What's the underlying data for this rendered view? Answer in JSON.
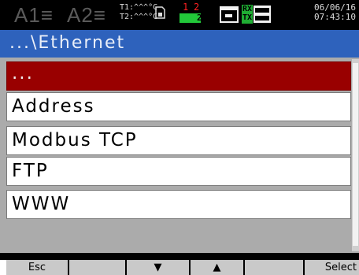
{
  "status_bar": {
    "alarm1": "A1≡",
    "alarm2": "A2≡",
    "t1": "T1:^^^°C",
    "t2": "T2:^^^°C",
    "channel_1": "1",
    "channel_2": "2",
    "channel_percent": "2%",
    "rx": "RX",
    "tx": "TX",
    "date": "06/06/16",
    "time": "07:43:10",
    "colors": {
      "alarm_inactive": "#5a5a5a",
      "channel_1": "#ff2020",
      "channel_2": "#ff2020",
      "bar_green": "#22c83a",
      "rx_bg": "#1fae33"
    }
  },
  "title_bar": {
    "path": "...\\Ethernet"
  },
  "menu": {
    "items": [
      {
        "label": "...",
        "selected": true
      },
      {
        "label": "Address",
        "selected": false
      },
      {
        "label": "Modbus TCP",
        "selected": false
      },
      {
        "label": "FTP",
        "selected": false
      },
      {
        "label": "WWW",
        "selected": false
      }
    ]
  },
  "softkeys": {
    "esc": "Esc",
    "down": "▼",
    "up": "▲",
    "select": "Select"
  },
  "colors": {
    "title_bg": "#2e62bc",
    "selected_bg": "#990000",
    "list_bg": "#ababab"
  }
}
